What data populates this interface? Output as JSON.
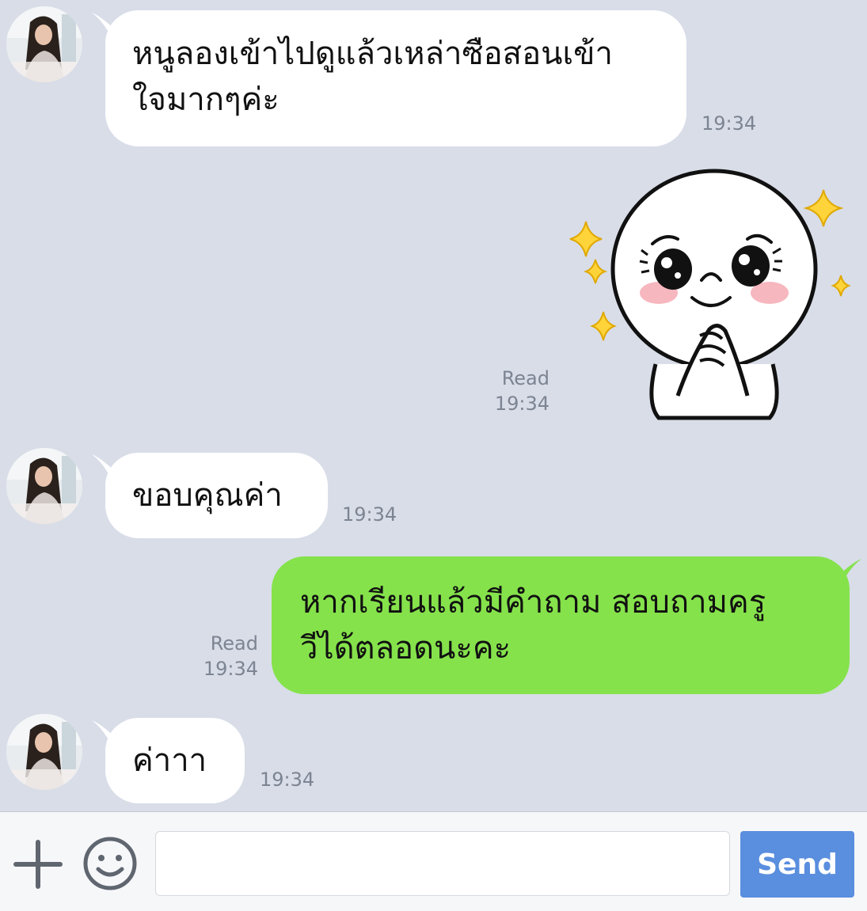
{
  "colors": {
    "chat_background": "#d8dde8",
    "incoming_bubble": "#ffffff",
    "outgoing_bubble": "#85e24b",
    "send_button": "#5a8ede",
    "meta_text": "#7d8492"
  },
  "messages": [
    {
      "direction": "incoming",
      "lines": [
        "หนูลองเข้าไปดูแล้วเหล่าซือสอนเข้า",
        "ใจมากๆค่ะ"
      ],
      "time": "19:34"
    },
    {
      "direction": "outgoing",
      "type": "sticker",
      "sticker": "moon-pleading-sticker",
      "read": "Read",
      "time": "19:34"
    },
    {
      "direction": "incoming",
      "lines": [
        "ขอบคุณค่า"
      ],
      "time": "19:34"
    },
    {
      "direction": "outgoing",
      "lines": [
        "หากเรียนแล้วมีคำถาม สอบถามครู",
        "วีได้ตลอดนะคะ"
      ],
      "read": "Read",
      "time": "19:34"
    },
    {
      "direction": "incoming",
      "lines": [
        "ค่าาา"
      ],
      "time": "19:34"
    }
  ],
  "input_bar": {
    "add_icon": "plus-icon",
    "emoji_icon": "smiley-icon",
    "placeholder": "",
    "send_label": "Send"
  }
}
